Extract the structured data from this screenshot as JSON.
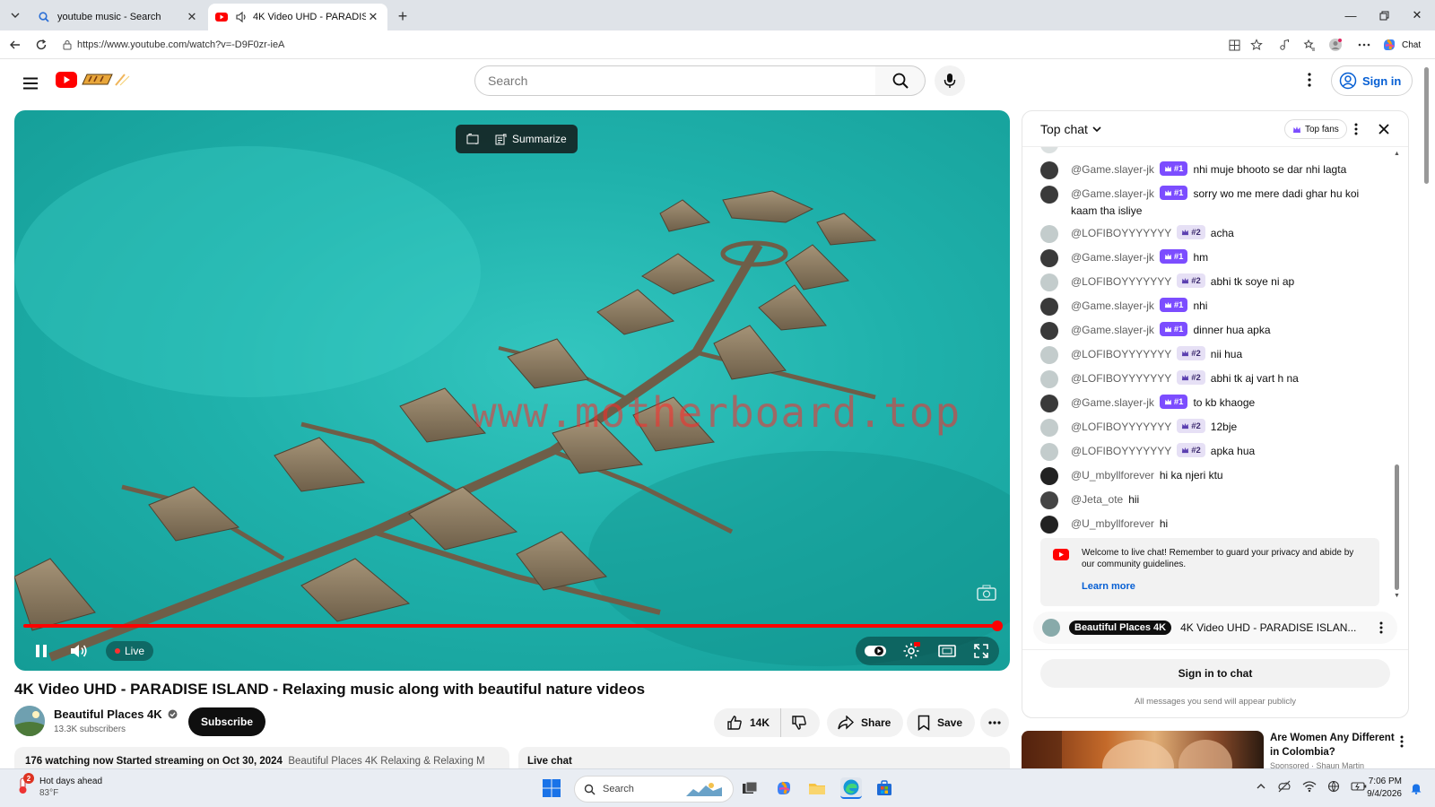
{
  "browser": {
    "tabs": [
      {
        "title": "youtube music - Search",
        "active": false
      },
      {
        "title": "4K Video UHD - PARADISE ISLA",
        "active": true
      }
    ],
    "url": "https://www.youtube.com/watch?v=-D9F0zr-ieA",
    "copilot_label": "Chat"
  },
  "youtube": {
    "search_placeholder": "Search",
    "signin_label": "Sign in"
  },
  "player": {
    "summarize_label": "Summarize",
    "watermark": "www.motherboard.top",
    "live_label": "Live",
    "progress": 1.0
  },
  "video": {
    "title": "4K Video UHD - PARADISE ISLAND - Relaxing music along with beautiful nature videos",
    "channel": "Beautiful Places 4K",
    "subscribers": "13.3K subscribers",
    "subscribe_label": "Subscribe",
    "likes": "14K",
    "share_label": "Share",
    "save_label": "Save"
  },
  "description": {
    "stats": "176 watching now  Started streaming on Oct 30, 2024",
    "tags": "Beautiful Places 4K",
    "tags2": "Relaxing & Relaxing M"
  },
  "livechat_tab": "Live chat",
  "chat": {
    "mode": "Top chat",
    "top_fans_label": "Top fans",
    "messages": [
      {
        "author": "@Game.slayer-jk",
        "rank": "#1",
        "text": "nhi muje bhooto se dar nhi lagta"
      },
      {
        "author": "@Game.slayer-jk",
        "rank": "#1",
        "text": "sorry wo me mere dadi ghar hu koi kaam tha isliye"
      },
      {
        "author": "@LOFIBOYYYYYYY",
        "rank": "#2",
        "text": "acha"
      },
      {
        "author": "@Game.slayer-jk",
        "rank": "#1",
        "text": "hm"
      },
      {
        "author": "@LOFIBOYYYYYYY",
        "rank": "#2",
        "text": "abhi tk soye ni ap"
      },
      {
        "author": "@Game.slayer-jk",
        "rank": "#1",
        "text": "nhi"
      },
      {
        "author": "@Game.slayer-jk",
        "rank": "#1",
        "text": "dinner hua apka"
      },
      {
        "author": "@LOFIBOYYYYYYY",
        "rank": "#2",
        "text": "nii hua"
      },
      {
        "author": "@LOFIBOYYYYYYY",
        "rank": "#2",
        "text": "abhi tk aj vart h na"
      },
      {
        "author": "@Game.slayer-jk",
        "rank": "#1",
        "text": "to kb khaoge"
      },
      {
        "author": "@LOFIBOYYYYYYY",
        "rank": "#2",
        "text": "12bje"
      },
      {
        "author": "@LOFIBOYYYYYYY",
        "rank": "#2",
        "text": "apka hua"
      },
      {
        "author": "@U_mbyllforever",
        "rank": "",
        "text": "hi ka njeri ktu"
      },
      {
        "author": "@Jeta_ote",
        "rank": "",
        "text": "hii"
      },
      {
        "author": "@U_mbyllforever",
        "rank": "",
        "text": "hi"
      }
    ],
    "welcome_text": "Welcome to live chat! Remember to guard your privacy and abide by our community guidelines.",
    "learn_more": "Learn more",
    "pinned_channel": "Beautiful Places 4K",
    "pinned_title": "4K Video UHD - PARADISE ISLAN...",
    "signin_chat": "Sign in to chat",
    "public_note": "All messages you send will appear publicly"
  },
  "recommendation": {
    "title": "Are Women Any Different in Colombia?",
    "subtitle": "Sponsored · Shaun Martin"
  },
  "taskbar": {
    "weather_title": "Hot days ahead",
    "weather_temp": "83°F",
    "weather_badge": "2",
    "search_label": "Search",
    "time": "7:06 PM",
    "date": "9/4/2026"
  }
}
